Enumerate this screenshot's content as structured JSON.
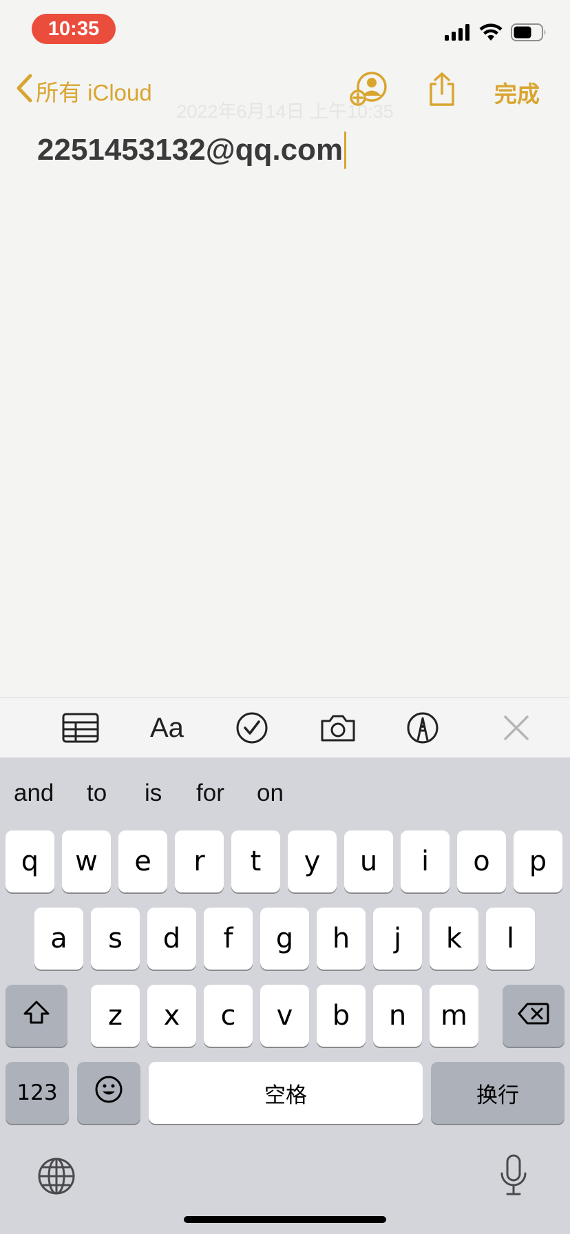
{
  "status_bar": {
    "time": "10:35",
    "icons": [
      "signal-icon",
      "wifi-icon",
      "battery-icon"
    ]
  },
  "nav": {
    "back_label": "所有 iCloud",
    "done_label": "完成",
    "icons": [
      "add-person-icon",
      "share-icon"
    ]
  },
  "note": {
    "date": "2022年6月14日 上午10:35",
    "text": "2251453132@qq.com"
  },
  "format_toolbar": {
    "text_style_label": "Aa",
    "icons": [
      "table-icon",
      "text-style-icon",
      "checklist-icon",
      "camera-icon",
      "markup-icon",
      "close-icon"
    ]
  },
  "keyboard": {
    "suggestions": [
      "and",
      "to",
      "is",
      "for",
      "on"
    ],
    "row1": [
      "q",
      "w",
      "e",
      "r",
      "t",
      "y",
      "u",
      "i",
      "o",
      "p"
    ],
    "row2": [
      "a",
      "s",
      "d",
      "f",
      "g",
      "h",
      "j",
      "k",
      "l"
    ],
    "row3": [
      "z",
      "x",
      "c",
      "v",
      "b",
      "n",
      "m"
    ],
    "numbers_label": "123",
    "space_label": "空格",
    "return_label": "换行",
    "icons": [
      "shift-icon",
      "delete-icon",
      "emoji-icon",
      "globe-icon",
      "microphone-icon"
    ]
  },
  "colors": {
    "accent": "#d9a52f",
    "time_pill": "#eb4d3d",
    "keyboard_bg": "#d3d5db",
    "function_key": "#adb1ba"
  }
}
